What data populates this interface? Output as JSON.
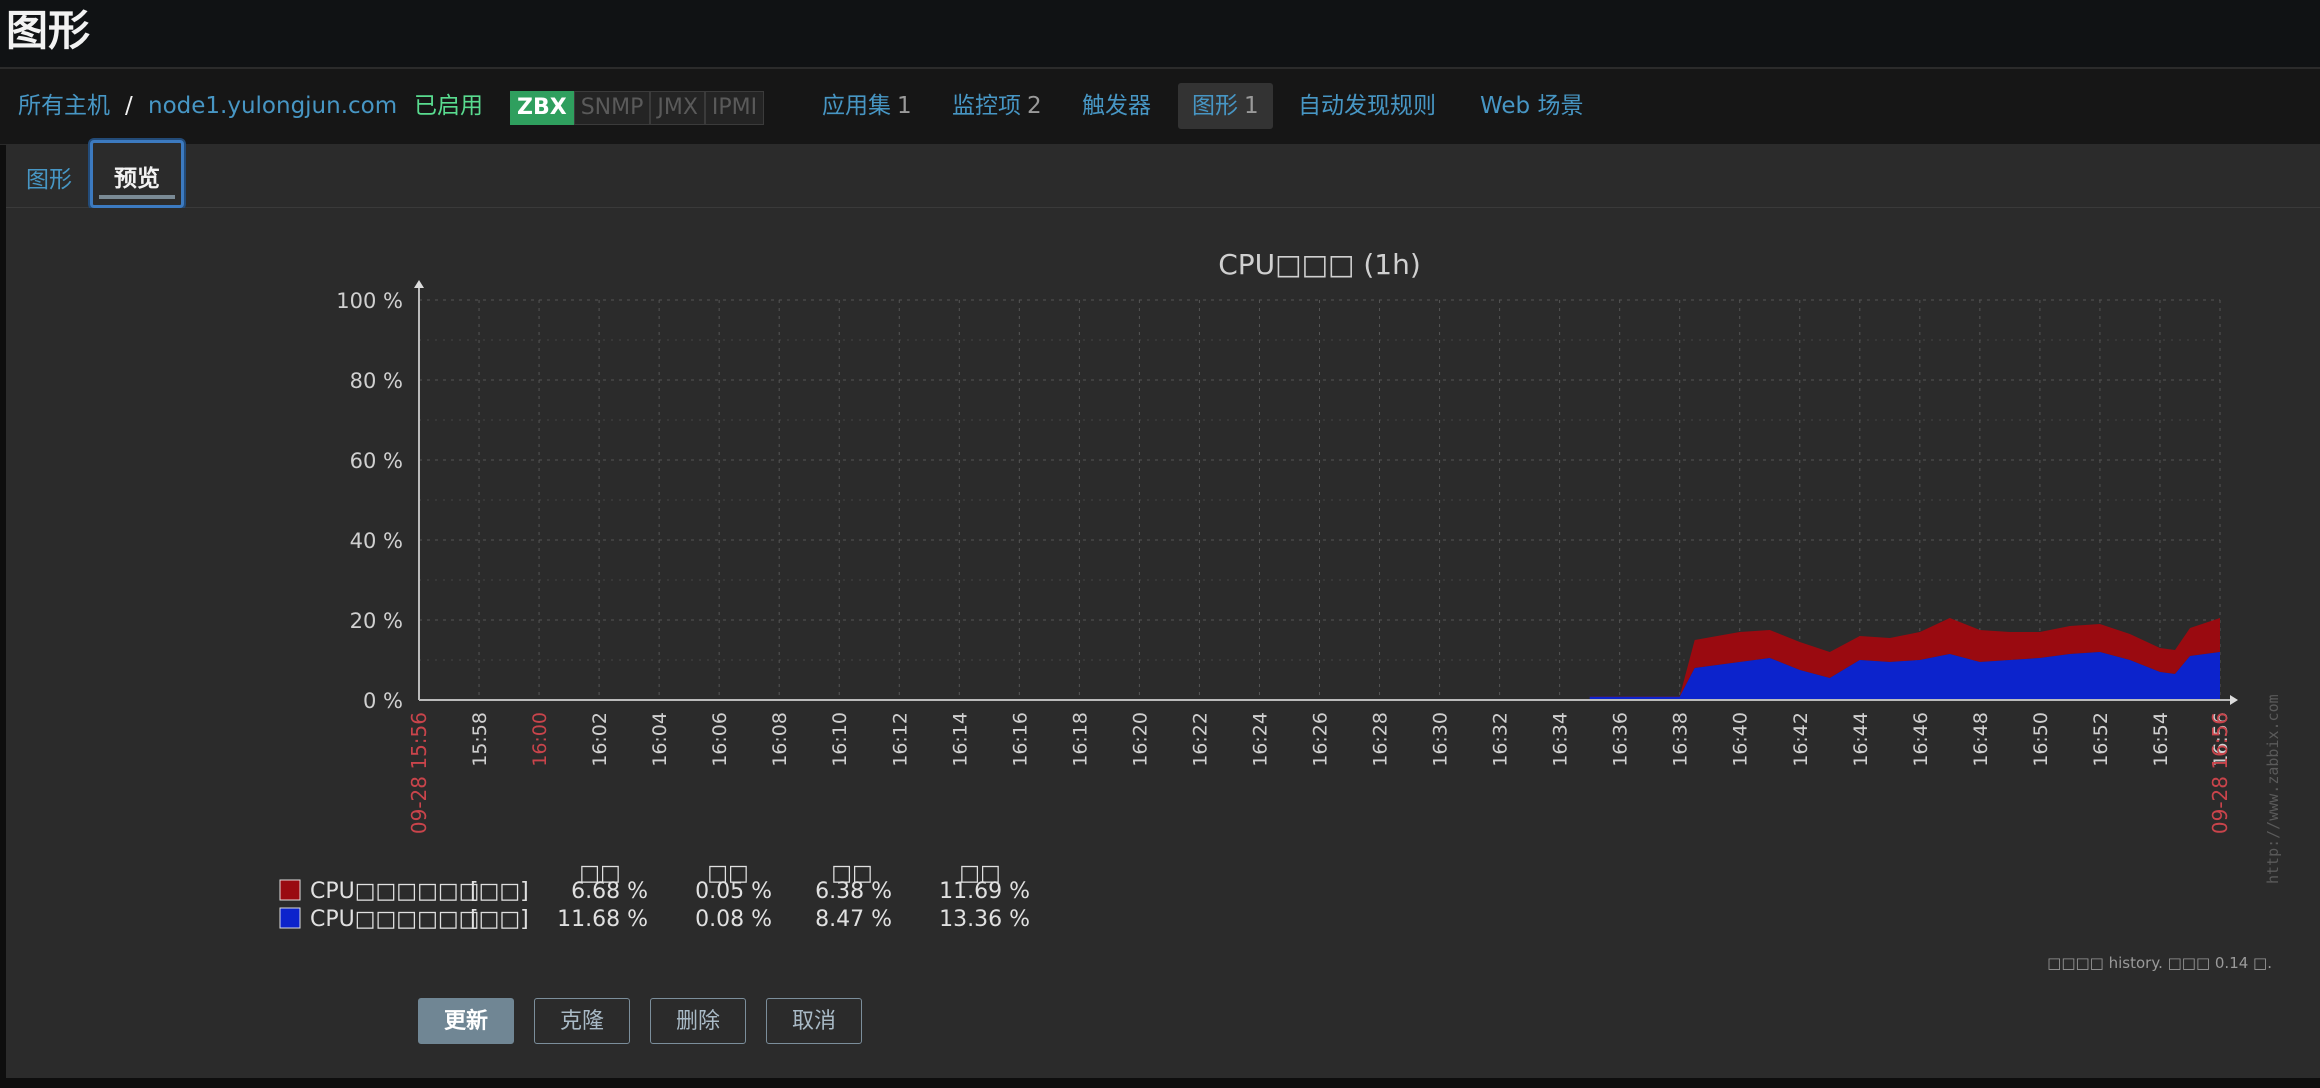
{
  "header": {
    "title": "图形"
  },
  "breadcrumb": {
    "all_hosts": "所有主机",
    "separator": "/",
    "host": "node1.yulongjun.com"
  },
  "status": {
    "enabled": "已启用"
  },
  "badges": [
    "ZBX",
    "SNMP",
    "JMX",
    "IPMI"
  ],
  "nav": {
    "applications": {
      "label": "应用集",
      "count": "1"
    },
    "items": {
      "label": "监控项",
      "count": "2"
    },
    "triggers": {
      "label": "触发器"
    },
    "graphs": {
      "label": "图形",
      "count": "1"
    },
    "discovery": {
      "label": "自动发现规则"
    },
    "web": {
      "label": "Web 场景"
    }
  },
  "subtabs": {
    "graph": "图形",
    "preview": "预览"
  },
  "buttons": {
    "update": "更新",
    "clone": "克隆",
    "delete": "删除",
    "cancel": "取消"
  },
  "colors": {
    "series1": "#9a0a10",
    "series2": "#0c23cc",
    "time_label_red": "#c9444b"
  },
  "chart_data": {
    "type": "area",
    "title": "CPU□□□ (1h)",
    "ylim": [
      0,
      100
    ],
    "y_ticks": [
      "0 %",
      "20 %",
      "40 %",
      "60 %",
      "80 %",
      "100 %"
    ],
    "x_start_label": "09-28 15:56",
    "x_end_label": "09-28 16:56",
    "x_ticks": [
      "15:58",
      "16:00",
      "16:02",
      "16:04",
      "16:06",
      "16:08",
      "16:10",
      "16:12",
      "16:14",
      "16:16",
      "16:18",
      "16:20",
      "16:22",
      "16:24",
      "16:26",
      "16:28",
      "16:30",
      "16:32",
      "16:34",
      "16:36",
      "16:38",
      "16:40",
      "16:42",
      "16:44",
      "16:46",
      "16:48",
      "16:50",
      "16:52",
      "16:54",
      "16:56"
    ],
    "stacked": true,
    "grid": true,
    "watermark": "http://www.zabbix.com",
    "footer_note": "□□□□ history. □□□ 0.14 □.",
    "legend_headers": [
      "□□",
      "□□",
      "□□",
      "□□"
    ],
    "series": [
      {
        "name": "CPU□□□□□□",
        "unit": "[□□]",
        "color": "#9a0a10",
        "stats": [
          "6.68 %",
          "0.05 %",
          "6.38 %",
          "11.69 %"
        ],
        "x": [
          "16:35",
          "16:38",
          "16:38.5",
          "16:40",
          "16:41",
          "16:42",
          "16:43",
          "16:44",
          "16:45",
          "16:46",
          "16:47",
          "16:48",
          "16:49",
          "16:50",
          "16:51",
          "16:52",
          "16:53",
          "16:54",
          "16:54.5",
          "16:55",
          "16:56"
        ],
        "values": [
          0.1,
          0.1,
          7.0,
          7.5,
          7.0,
          7.0,
          6.5,
          6.0,
          6.0,
          7.0,
          9.0,
          8.0,
          7.0,
          6.5,
          7.0,
          7.0,
          6.5,
          6.0,
          6.0,
          7.0,
          8.5
        ]
      },
      {
        "name": "CPU□□□□□□",
        "unit": "[□□]",
        "color": "#0c23cc",
        "stats": [
          "11.68 %",
          "0.08 %",
          "8.47 %",
          "13.36 %"
        ],
        "x": [
          "16:35",
          "16:38",
          "16:38.5",
          "16:40",
          "16:41",
          "16:42",
          "16:43",
          "16:44",
          "16:45",
          "16:46",
          "16:47",
          "16:48",
          "16:49",
          "16:50",
          "16:51",
          "16:52",
          "16:53",
          "16:54",
          "16:54.5",
          "16:55",
          "16:56"
        ],
        "values": [
          0.8,
          0.8,
          8.0,
          9.5,
          10.5,
          7.5,
          5.5,
          10.0,
          9.5,
          10.0,
          11.5,
          9.5,
          10.0,
          10.5,
          11.5,
          12.0,
          10.0,
          7.0,
          6.5,
          11.0,
          12.0
        ]
      }
    ]
  }
}
